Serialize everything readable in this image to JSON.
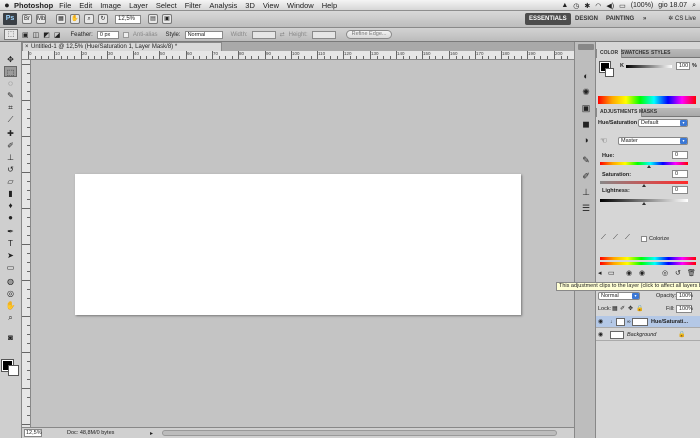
{
  "menubar": {
    "apple": "",
    "app_name": "Photoshop",
    "items": [
      "File",
      "Edit",
      "Image",
      "Layer",
      "Select",
      "Filter",
      "Analysis",
      "3D",
      "View",
      "Window",
      "Help"
    ],
    "battery": "(100%)",
    "clock": "gio 18.07"
  },
  "appbar": {
    "logo": "Ps",
    "zoom": "12,5%",
    "workspaces": [
      "ESSENTIALS",
      "DESIGN",
      "PAINTING"
    ],
    "more": "»",
    "cslive": "CS Live"
  },
  "options": {
    "feather_label": "Feather:",
    "feather_value": "0 px",
    "antialias_label": "Anti-alias",
    "style_label": "Style:",
    "style_value": "Normal",
    "width_label": "Width:",
    "height_label": "Height:",
    "refine_label": "Refine Edge..."
  },
  "document": {
    "tab_title": "Untitled-1 @ 12,5% (Hue/Saturation 1, Layer Mask/8) *",
    "close": "×",
    "ruler_labels": [
      "0",
      "10",
      "20",
      "30",
      "40",
      "50",
      "60",
      "70",
      "80",
      "90",
      "100",
      "110",
      "120",
      "130",
      "140",
      "150",
      "160",
      "170",
      "180",
      "190",
      "200"
    ]
  },
  "status": {
    "zoom": "12,5%",
    "doc_info": "Doc: 48,8M/0 bytes"
  },
  "panels": {
    "color_tabs": [
      "COLOR",
      "SWATCHES",
      "STYLES"
    ],
    "color_k_label": "K",
    "color_k_value": "100",
    "color_k_unit": "%",
    "adj_tabs": [
      "ADJUSTMENTS",
      "MASKS"
    ],
    "adj_title": "Hue/Saturation",
    "preset_value": "Default",
    "channel_value": "Master",
    "hue_label": "Hue:",
    "hue_value": "0",
    "saturation_label": "Saturation:",
    "saturation_value": "0",
    "lightness_label": "Lightness:",
    "lightness_value": "0",
    "colorize_label": "Colorize",
    "tooltip": "This adjustment clips to the layer (click to affect all layers below)",
    "layers": {
      "blend_mode": "Normal",
      "opacity_label": "Opacity:",
      "opacity_value": "100%",
      "lock_label": "Lock:",
      "fill_label": "Fill:",
      "fill_value": "100%",
      "rows": [
        {
          "name": "Hue/Saturati..."
        },
        {
          "name": "Background"
        }
      ]
    }
  },
  "colors": {
    "accent": "#3b78d6",
    "canvas_bg": "#c4c4c4",
    "document_bg": "#ffffff",
    "foreground_swatch": "#000000",
    "background_swatch": "#ffffff"
  },
  "icons": {
    "tools": [
      "move-icon",
      "marquee-icon",
      "lasso-icon",
      "quick-select-icon",
      "crop-icon",
      "eyedropper-icon",
      "healing-icon",
      "brush-icon",
      "stamp-icon",
      "history-brush-icon",
      "eraser-icon",
      "gradient-icon",
      "blur-icon",
      "dodge-icon",
      "pen-icon",
      "type-icon",
      "path-select-icon",
      "shape-icon",
      "3d-rotate-icon",
      "3d-orbit-icon",
      "hand-icon",
      "zoom-icon"
    ],
    "dock": [
      "color-panel-icon",
      "adjustments-panel-icon",
      "masks-panel-icon",
      "layers-panel-icon",
      "channels-panel-icon",
      "paths-panel-icon",
      "brush-panel-icon",
      "clone-source-icon",
      "history-icon"
    ]
  }
}
